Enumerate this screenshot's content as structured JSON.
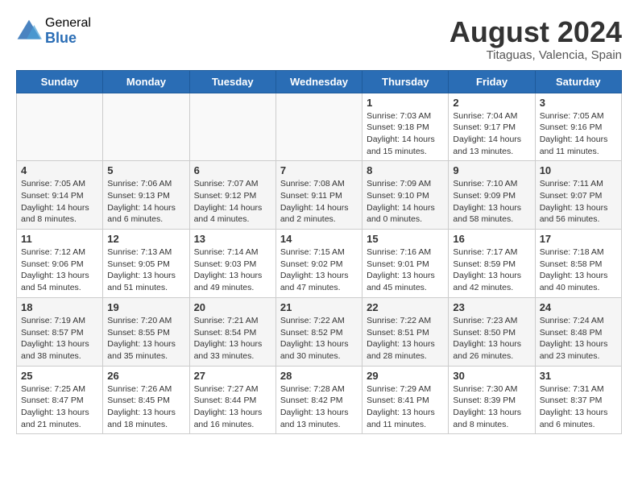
{
  "header": {
    "logo_general": "General",
    "logo_blue": "Blue",
    "month_title": "August 2024",
    "subtitle": "Titaguas, Valencia, Spain"
  },
  "weekdays": [
    "Sunday",
    "Monday",
    "Tuesday",
    "Wednesday",
    "Thursday",
    "Friday",
    "Saturday"
  ],
  "weeks": [
    [
      {
        "day": "",
        "info": ""
      },
      {
        "day": "",
        "info": ""
      },
      {
        "day": "",
        "info": ""
      },
      {
        "day": "",
        "info": ""
      },
      {
        "day": "1",
        "info": "Sunrise: 7:03 AM\nSunset: 9:18 PM\nDaylight: 14 hours\nand 15 minutes."
      },
      {
        "day": "2",
        "info": "Sunrise: 7:04 AM\nSunset: 9:17 PM\nDaylight: 14 hours\nand 13 minutes."
      },
      {
        "day": "3",
        "info": "Sunrise: 7:05 AM\nSunset: 9:16 PM\nDaylight: 14 hours\nand 11 minutes."
      }
    ],
    [
      {
        "day": "4",
        "info": "Sunrise: 7:05 AM\nSunset: 9:14 PM\nDaylight: 14 hours\nand 8 minutes."
      },
      {
        "day": "5",
        "info": "Sunrise: 7:06 AM\nSunset: 9:13 PM\nDaylight: 14 hours\nand 6 minutes."
      },
      {
        "day": "6",
        "info": "Sunrise: 7:07 AM\nSunset: 9:12 PM\nDaylight: 14 hours\nand 4 minutes."
      },
      {
        "day": "7",
        "info": "Sunrise: 7:08 AM\nSunset: 9:11 PM\nDaylight: 14 hours\nand 2 minutes."
      },
      {
        "day": "8",
        "info": "Sunrise: 7:09 AM\nSunset: 9:10 PM\nDaylight: 14 hours\nand 0 minutes."
      },
      {
        "day": "9",
        "info": "Sunrise: 7:10 AM\nSunset: 9:09 PM\nDaylight: 13 hours\nand 58 minutes."
      },
      {
        "day": "10",
        "info": "Sunrise: 7:11 AM\nSunset: 9:07 PM\nDaylight: 13 hours\nand 56 minutes."
      }
    ],
    [
      {
        "day": "11",
        "info": "Sunrise: 7:12 AM\nSunset: 9:06 PM\nDaylight: 13 hours\nand 54 minutes."
      },
      {
        "day": "12",
        "info": "Sunrise: 7:13 AM\nSunset: 9:05 PM\nDaylight: 13 hours\nand 51 minutes."
      },
      {
        "day": "13",
        "info": "Sunrise: 7:14 AM\nSunset: 9:03 PM\nDaylight: 13 hours\nand 49 minutes."
      },
      {
        "day": "14",
        "info": "Sunrise: 7:15 AM\nSunset: 9:02 PM\nDaylight: 13 hours\nand 47 minutes."
      },
      {
        "day": "15",
        "info": "Sunrise: 7:16 AM\nSunset: 9:01 PM\nDaylight: 13 hours\nand 45 minutes."
      },
      {
        "day": "16",
        "info": "Sunrise: 7:17 AM\nSunset: 8:59 PM\nDaylight: 13 hours\nand 42 minutes."
      },
      {
        "day": "17",
        "info": "Sunrise: 7:18 AM\nSunset: 8:58 PM\nDaylight: 13 hours\nand 40 minutes."
      }
    ],
    [
      {
        "day": "18",
        "info": "Sunrise: 7:19 AM\nSunset: 8:57 PM\nDaylight: 13 hours\nand 38 minutes."
      },
      {
        "day": "19",
        "info": "Sunrise: 7:20 AM\nSunset: 8:55 PM\nDaylight: 13 hours\nand 35 minutes."
      },
      {
        "day": "20",
        "info": "Sunrise: 7:21 AM\nSunset: 8:54 PM\nDaylight: 13 hours\nand 33 minutes."
      },
      {
        "day": "21",
        "info": "Sunrise: 7:22 AM\nSunset: 8:52 PM\nDaylight: 13 hours\nand 30 minutes."
      },
      {
        "day": "22",
        "info": "Sunrise: 7:22 AM\nSunset: 8:51 PM\nDaylight: 13 hours\nand 28 minutes."
      },
      {
        "day": "23",
        "info": "Sunrise: 7:23 AM\nSunset: 8:50 PM\nDaylight: 13 hours\nand 26 minutes."
      },
      {
        "day": "24",
        "info": "Sunrise: 7:24 AM\nSunset: 8:48 PM\nDaylight: 13 hours\nand 23 minutes."
      }
    ],
    [
      {
        "day": "25",
        "info": "Sunrise: 7:25 AM\nSunset: 8:47 PM\nDaylight: 13 hours\nand 21 minutes."
      },
      {
        "day": "26",
        "info": "Sunrise: 7:26 AM\nSunset: 8:45 PM\nDaylight: 13 hours\nand 18 minutes."
      },
      {
        "day": "27",
        "info": "Sunrise: 7:27 AM\nSunset: 8:44 PM\nDaylight: 13 hours\nand 16 minutes."
      },
      {
        "day": "28",
        "info": "Sunrise: 7:28 AM\nSunset: 8:42 PM\nDaylight: 13 hours\nand 13 minutes."
      },
      {
        "day": "29",
        "info": "Sunrise: 7:29 AM\nSunset: 8:41 PM\nDaylight: 13 hours\nand 11 minutes."
      },
      {
        "day": "30",
        "info": "Sunrise: 7:30 AM\nSunset: 8:39 PM\nDaylight: 13 hours\nand 8 minutes."
      },
      {
        "day": "31",
        "info": "Sunrise: 7:31 AM\nSunset: 8:37 PM\nDaylight: 13 hours\nand 6 minutes."
      }
    ]
  ]
}
